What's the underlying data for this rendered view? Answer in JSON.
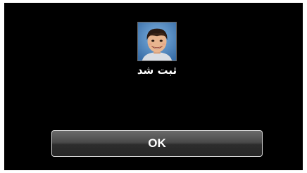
{
  "dialog": {
    "status_message": "ثبت شد",
    "face_thumbnail_icon": "child-face-photo",
    "ok_label": "OK"
  },
  "colors": {
    "panel_background": "#000000",
    "text": "#ffffff",
    "button_border": "#d9d9d9"
  }
}
